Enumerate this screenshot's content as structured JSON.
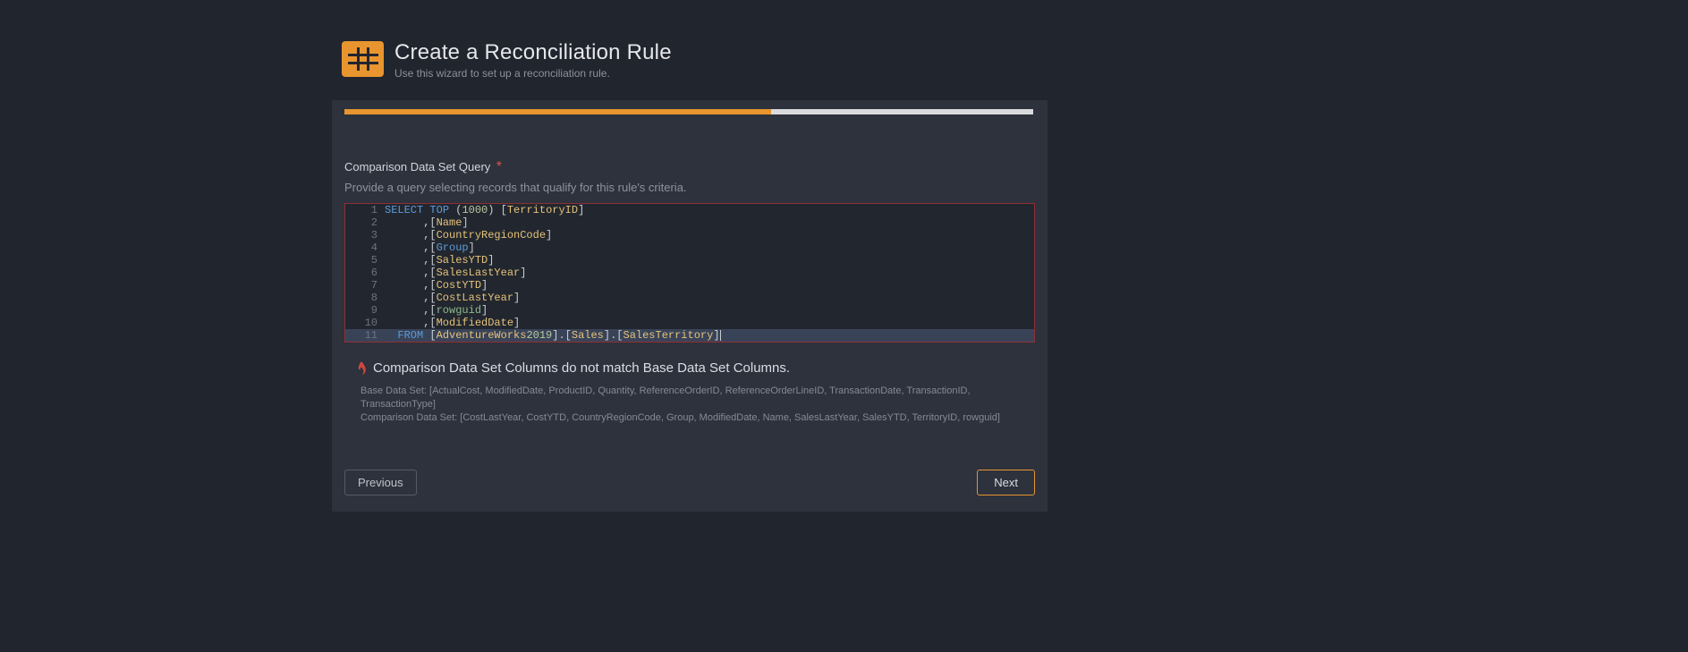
{
  "header": {
    "title": "Create a Reconciliation Rule",
    "subtitle": "Use this wizard to set up a reconciliation rule."
  },
  "progress_percent": 62,
  "section": {
    "label": "Comparison Data Set Query",
    "required_mark": "*",
    "help": "Provide a query selecting records that qualify for this rule's criteria."
  },
  "editor": {
    "lines": [
      {
        "n": "1",
        "tokens": [
          {
            "t": "SELECT",
            "c": "kw-blue"
          },
          {
            "t": " ",
            "c": "punct"
          },
          {
            "t": "TOP",
            "c": "kw-blue"
          },
          {
            "t": " (",
            "c": "punct"
          },
          {
            "t": "1000",
            "c": "number"
          },
          {
            "t": ") [",
            "c": "punct"
          },
          {
            "t": "TerritoryID",
            "c": "ident"
          },
          {
            "t": "]",
            "c": "punct"
          }
        ]
      },
      {
        "n": "2",
        "tokens": [
          {
            "t": "      ,[",
            "c": "punct"
          },
          {
            "t": "Name",
            "c": "ident"
          },
          {
            "t": "]",
            "c": "punct"
          }
        ]
      },
      {
        "n": "3",
        "tokens": [
          {
            "t": "      ,[",
            "c": "punct"
          },
          {
            "t": "CountryRegionCode",
            "c": "ident"
          },
          {
            "t": "]",
            "c": "punct"
          }
        ]
      },
      {
        "n": "4",
        "tokens": [
          {
            "t": "      ,[",
            "c": "punct"
          },
          {
            "t": "Group",
            "c": "kw-blue"
          },
          {
            "t": "]",
            "c": "punct"
          }
        ]
      },
      {
        "n": "5",
        "tokens": [
          {
            "t": "      ,[",
            "c": "punct"
          },
          {
            "t": "SalesYTD",
            "c": "ident"
          },
          {
            "t": "]",
            "c": "punct"
          }
        ]
      },
      {
        "n": "6",
        "tokens": [
          {
            "t": "      ,[",
            "c": "punct"
          },
          {
            "t": "SalesLastYear",
            "c": "ident"
          },
          {
            "t": "]",
            "c": "punct"
          }
        ]
      },
      {
        "n": "7",
        "tokens": [
          {
            "t": "      ,[",
            "c": "punct"
          },
          {
            "t": "CostYTD",
            "c": "ident"
          },
          {
            "t": "]",
            "c": "punct"
          }
        ]
      },
      {
        "n": "8",
        "tokens": [
          {
            "t": "      ,[",
            "c": "punct"
          },
          {
            "t": "CostLastYear",
            "c": "ident"
          },
          {
            "t": "]",
            "c": "punct"
          }
        ]
      },
      {
        "n": "9",
        "tokens": [
          {
            "t": "      ,[",
            "c": "punct"
          },
          {
            "t": "rowguid",
            "c": "kw-green"
          },
          {
            "t": "]",
            "c": "punct"
          }
        ]
      },
      {
        "n": "10",
        "tokens": [
          {
            "t": "      ,[",
            "c": "punct"
          },
          {
            "t": "ModifiedDate",
            "c": "ident"
          },
          {
            "t": "]",
            "c": "punct"
          }
        ]
      },
      {
        "n": "11",
        "tokens": [
          {
            "t": "  ",
            "c": "punct"
          },
          {
            "t": "FROM",
            "c": "kw-blue"
          },
          {
            "t": " [",
            "c": "punct"
          },
          {
            "t": "AdventureWorks",
            "c": "ident"
          },
          {
            "t": "2019",
            "c": "number"
          },
          {
            "t": "].[",
            "c": "punct"
          },
          {
            "t": "Sales",
            "c": "ident"
          },
          {
            "t": "].[",
            "c": "punct"
          },
          {
            "t": "SalesTerritory",
            "c": "ident"
          },
          {
            "t": "]",
            "c": "punct"
          }
        ],
        "highlight": true,
        "cursor": true
      }
    ]
  },
  "warning": {
    "title": "Comparison Data Set Columns do not match Base Data Set Columns.",
    "base_line": "Base Data Set: [ActualCost, ModifiedDate, ProductID, Quantity, ReferenceOrderID, ReferenceOrderLineID, TransactionDate, TransactionID, TransactionType]",
    "comp_line": "Comparison Data Set: [CostLastYear, CostYTD, CountryRegionCode, Group, ModifiedDate, Name, SalesLastYear, SalesYTD, TerritoryID, rowguid]"
  },
  "buttons": {
    "previous": "Previous",
    "next": "Next"
  }
}
